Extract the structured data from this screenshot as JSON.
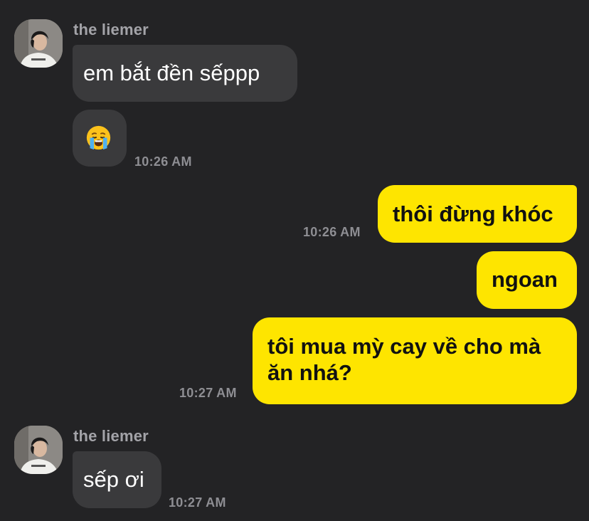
{
  "chat": {
    "group1": {
      "sender_name": "the liemer",
      "message1": "em bắt đền sếppp",
      "message2_emoji": "crying-face-emoji",
      "time": "10:26 AM"
    },
    "group2": {
      "time": "10:26 AM",
      "message1": "thôi đừng khóc",
      "message2": "ngoan"
    },
    "group3": {
      "line1": "tôi mua mỳ cay về cho mà",
      "line2": "ăn nhá?",
      "time": "10:27 AM"
    },
    "group4": {
      "sender_name": "the liemer",
      "message1": "sếp ơi",
      "time": "10:27 AM"
    }
  },
  "colors": {
    "background": "#232325",
    "incoming_bubble": "#3a3a3c",
    "outgoing_bubble": "#fee500"
  }
}
